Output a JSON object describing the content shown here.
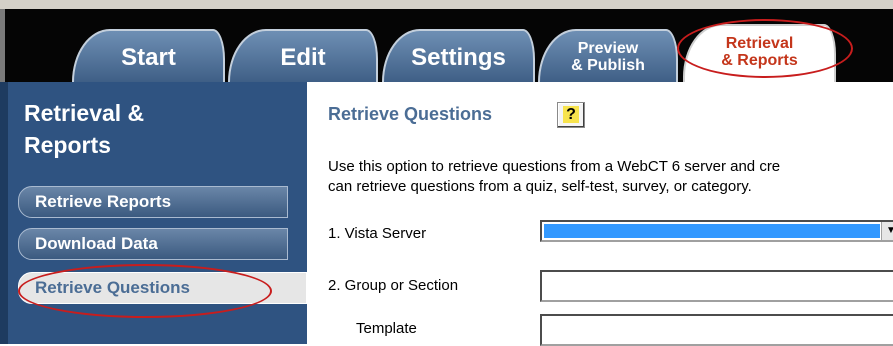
{
  "tabs": [
    {
      "label": "Start"
    },
    {
      "label": "Edit"
    },
    {
      "label": "Settings"
    },
    {
      "label_line1": "Preview",
      "label_line2": "& Publish"
    },
    {
      "label_line1": "Retrieval",
      "label_line2": "& Reports",
      "active": true
    }
  ],
  "sidebar": {
    "title_line1": "Retrieval &",
    "title_line2": "Reports",
    "items": [
      {
        "label": "Retrieve Reports"
      },
      {
        "label": "Download Data"
      },
      {
        "label": "Retrieve Questions",
        "active": true
      }
    ]
  },
  "main": {
    "title": "Retrieve Questions",
    "help_label": "?",
    "description_line1": "Use this option to retrieve questions from a WebCT 6 server and cre",
    "description_line2": "can retrieve questions from a quiz, self-test, survey, or category.",
    "fields": [
      {
        "label": "1.  Vista Server",
        "value": "",
        "type": "select"
      },
      {
        "label": "2.  Group or Section",
        "value": "",
        "type": "text"
      },
      {
        "label": "Template",
        "value": "",
        "type": "text"
      }
    ]
  },
  "colors": {
    "tab_bar": "#050505",
    "sidebar": "#2f5381",
    "accent": "#4b6d95",
    "annotation": "#c81d1d",
    "selection": "#3399ff"
  }
}
